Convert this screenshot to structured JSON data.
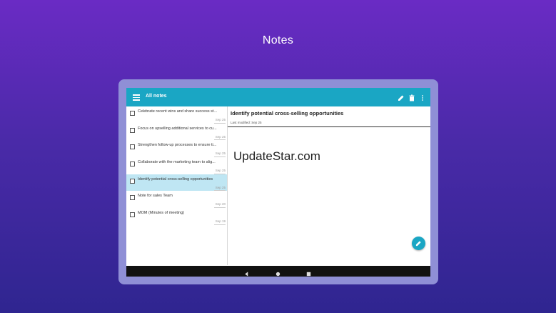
{
  "hero": {
    "title": "Notes"
  },
  "appbar": {
    "title": "All notes",
    "menu_icon": "menu-icon",
    "actions": [
      "edit-icon",
      "delete-icon",
      "more-vert-icon"
    ]
  },
  "notes": [
    {
      "title": "Celebrate recent wins and share success st...",
      "date": "Sep 25",
      "selected": false
    },
    {
      "title": "Focus on upselling additional services to cu...",
      "date": "Sep 25",
      "selected": false
    },
    {
      "title": "Strengthen follow-up processes to ensure ti...",
      "date": "Sep 25",
      "selected": false
    },
    {
      "title": "Collaborate with the marketing team to alig...",
      "date": "Sep 25",
      "selected": false
    },
    {
      "title": "Identify potential cross-selling opportunities",
      "date": "Sep 25",
      "selected": true
    },
    {
      "title": " Note for sales Team",
      "date": "Sep 20",
      "selected": false
    },
    {
      "title": "MOM (Minutes of meeting)",
      "date": "Sep 19",
      "selected": false
    }
  ],
  "detail": {
    "title": "Identify potential cross-selling opportunities",
    "modified": "Last modified: Sep 25",
    "watermark": "UpdateStar.com"
  },
  "colors": {
    "accent": "#1aa6c4",
    "selected_row": "#bfe6f3",
    "background_top": "#6a2bc4",
    "background_bottom": "#2f2590"
  }
}
